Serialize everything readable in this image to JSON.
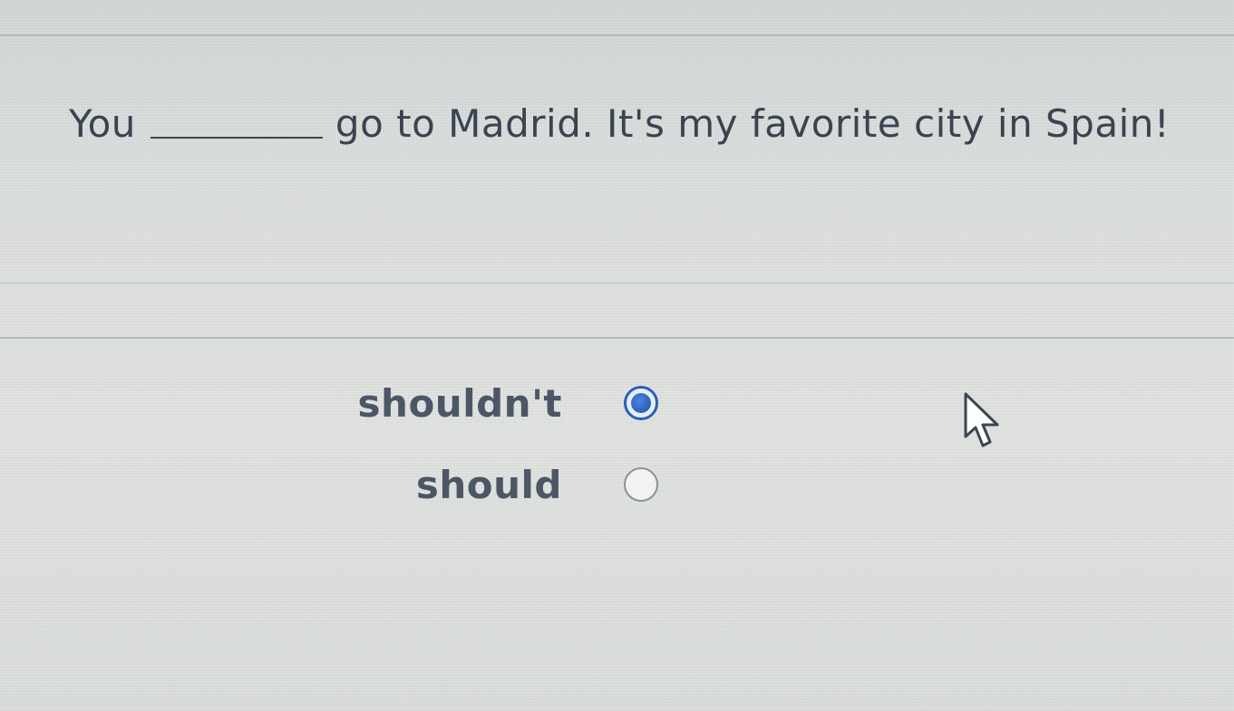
{
  "question": {
    "prefix": "You",
    "suffix": "go to Madrid. It's my favorite city in Spain!"
  },
  "options": [
    {
      "label": "shouldn't",
      "selected": true
    },
    {
      "label": "should",
      "selected": false
    }
  ],
  "colors": {
    "accent": "#2a5fb8",
    "text": "#3a4450"
  },
  "icons": {
    "cursor": "arrow-cursor-icon"
  }
}
